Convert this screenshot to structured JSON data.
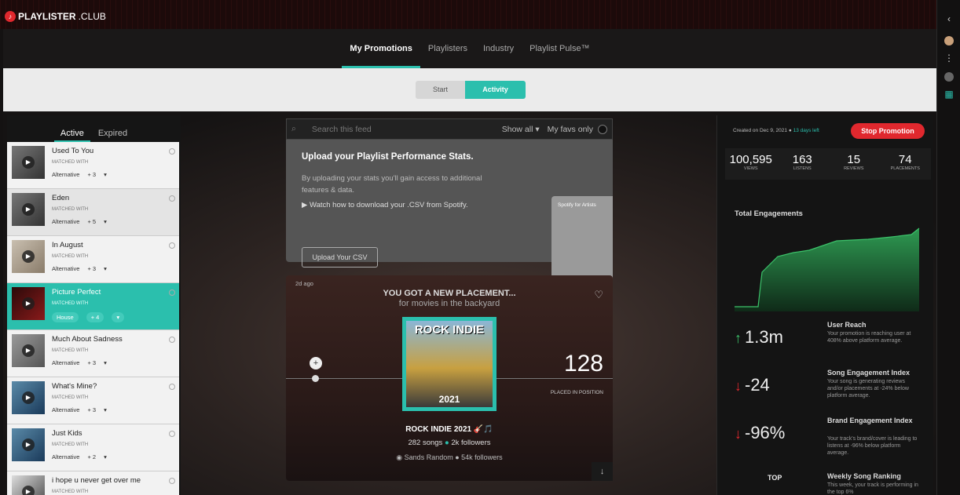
{
  "brand": {
    "name": "PLAYLISTER",
    "suffix": ".CLUB"
  },
  "nav": {
    "tabs": [
      "My Promotions",
      "Playlisters",
      "Industry",
      "Playlist Pulse™"
    ]
  },
  "segment": {
    "start": "Start",
    "activity": "Activity"
  },
  "left": {
    "tabs": [
      "Active",
      "Expired"
    ],
    "matched_label": "MATCHED WITH",
    "items": [
      {
        "title": "Used To You",
        "genre": "Alternative",
        "more": "+ 3"
      },
      {
        "title": "Eden",
        "genre": "Alternative",
        "more": "+ 5"
      },
      {
        "title": "In August",
        "genre": "Alternative",
        "more": "+ 3"
      },
      {
        "title": "Picture Perfect",
        "genre": "House",
        "more": "+ 4"
      },
      {
        "title": "Much About Sadness",
        "genre": "Alternative",
        "more": "+ 3"
      },
      {
        "title": "What's Mine?",
        "genre": "Alternative",
        "more": "+ 3"
      },
      {
        "title": "Just Kids",
        "genre": "Alternative",
        "more": "+ 2"
      },
      {
        "title": "i hope u never get over me",
        "genre": "",
        "more": ""
      }
    ]
  },
  "feed": {
    "search_placeholder": "Search this feed",
    "show_all": "Show all",
    "my_favs": "My favs only",
    "upload": {
      "title": "Upload your Playlist Performance Stats.",
      "body": "By uploading your stats you'll gain access to additional features & data.",
      "watch": "Watch how to download your .CSV from Spotify.",
      "button": "Upload Your CSV",
      "spotify_label": "Spotify for Artists"
    },
    "placement": {
      "ago": "2d ago",
      "headline": "YOU GOT A NEW PLACEMENT...",
      "song": "for movies in the backyard",
      "cover_title": "ROCK INDIE",
      "cover_year": "2021",
      "position": "128",
      "position_label": "PLACED IN POSITION",
      "playlist_name": "ROCK INDIE 2021 🎸🎵",
      "songs": "282 songs",
      "followers": "2k followers",
      "curator": "Sands Random",
      "curator_followers": "54k followers"
    }
  },
  "right": {
    "created": "Created on Dec 9, 2021",
    "days_left": "13 days left",
    "stop_button": "Stop Promotion",
    "stats": [
      {
        "value": "100,595",
        "label": "VIEWS"
      },
      {
        "value": "163",
        "label": "LISTENS"
      },
      {
        "value": "15",
        "label": "REVIEWS"
      },
      {
        "value": "74",
        "label": "PLACEMENTS"
      }
    ],
    "engagement_title": "Total Engagements",
    "metrics": [
      {
        "value": "1.3m",
        "dir": "up",
        "title": "User Reach",
        "desc": "Your promotion is reaching user at 408% above platform average."
      },
      {
        "value": "-24",
        "dir": "down",
        "title": "Song Engagement Index",
        "desc": "Your song is generating reviews and/or placements at -24% below platform average."
      },
      {
        "value": "-96%",
        "dir": "down",
        "title": "Brand Engagement Index",
        "desc": "Your track's brand/cover is leading to listens at -96% below platform average."
      },
      {
        "value": "TOP",
        "dir": "",
        "title": "Weekly Song Ranking",
        "desc": "This week, your track is performing in the top 6%"
      }
    ]
  },
  "colors": {
    "accent": "#2bbfad",
    "danger": "#e0282e"
  }
}
